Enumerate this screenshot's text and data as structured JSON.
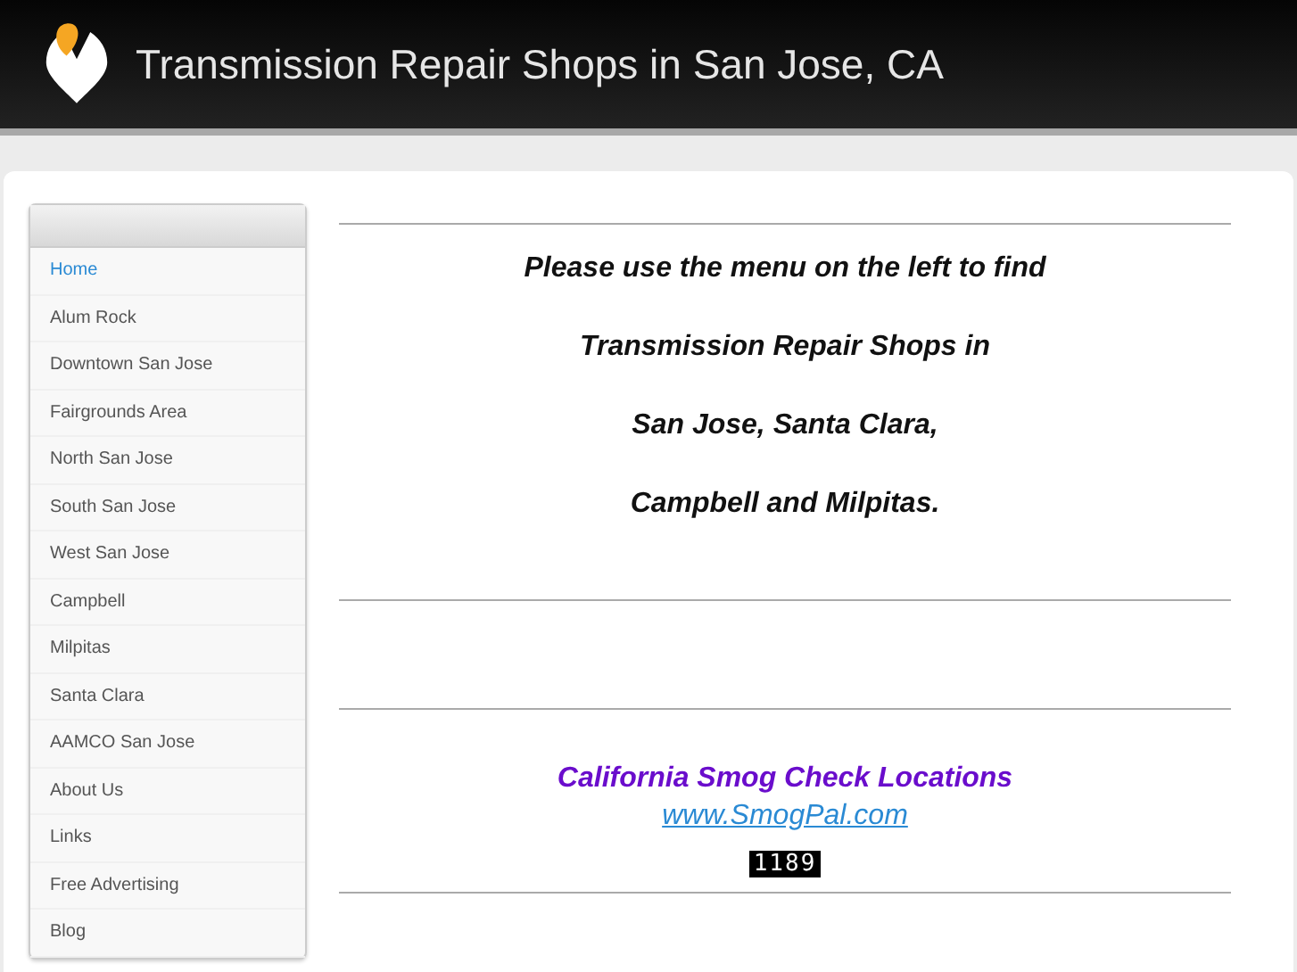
{
  "header": {
    "title": "Transmission Repair Shops in San Jose, CA"
  },
  "sidebar": {
    "items": [
      {
        "label": "Home",
        "selected": true
      },
      {
        "label": "Alum Rock",
        "selected": false
      },
      {
        "label": "Downtown San Jose",
        "selected": false
      },
      {
        "label": "Fairgrounds Area",
        "selected": false
      },
      {
        "label": "North San Jose",
        "selected": false
      },
      {
        "label": "South San Jose",
        "selected": false
      },
      {
        "label": "West San Jose",
        "selected": false
      },
      {
        "label": "Campbell",
        "selected": false
      },
      {
        "label": "Milpitas",
        "selected": false
      },
      {
        "label": "Santa Clara",
        "selected": false
      },
      {
        "label": "AAMCO San Jose",
        "selected": false
      },
      {
        "label": "About Us",
        "selected": false
      },
      {
        "label": "Links",
        "selected": false
      },
      {
        "label": "Free Advertising",
        "selected": false
      },
      {
        "label": "Blog",
        "selected": false
      }
    ]
  },
  "intro": [
    "Please use the menu on the left to find",
    "Transmission Repair Shops in",
    "San Jose, Santa Clara,",
    "Campbell and Milpitas."
  ],
  "promo": {
    "heading": "California Smog Check Locations",
    "link": "www.SmogPal.com",
    "counter": "1189"
  }
}
